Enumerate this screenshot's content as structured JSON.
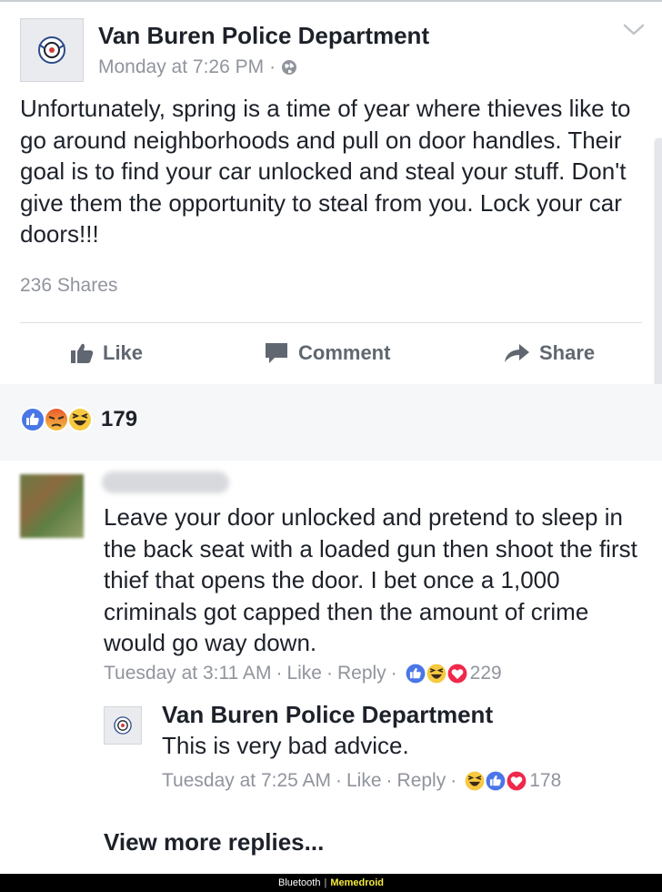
{
  "post": {
    "page_name": "Van Buren Police Department",
    "timestamp": "Monday at 7:26 PM",
    "separator": "·",
    "audience_icon": "globe-icon",
    "body": "Unfortunately, spring is a time of year where thieves like to go around neighborhoods and pull on door handles. Their goal is to find your car unlocked and steal your stuff. Don't give them the opportunity to steal from you. Lock your car doors!!!",
    "shares": "236 Shares",
    "actions": {
      "like": "Like",
      "comment": "Comment",
      "share": "Share"
    },
    "reaction_icons": [
      "like-reaction-icon",
      "angry-reaction-icon",
      "haha-reaction-icon"
    ],
    "reaction_count": "179"
  },
  "comment": {
    "text": "Leave your door unlocked and pretend to sleep in the back seat with a loaded gun then shoot the first thief that opens the door. I bet once a 1,000 criminals got capped then the amount of crime would go way down.",
    "timestamp": "Tuesday at 3:11 AM",
    "like": "Like",
    "reply": "Reply",
    "reaction_icons": [
      "like-reaction-icon",
      "haha-reaction-icon",
      "love-reaction-icon"
    ],
    "reaction_count": "229",
    "sep": "·"
  },
  "reply": {
    "name": "Van Buren Police Department",
    "text": "This is very bad advice.",
    "timestamp": "Tuesday at 7:25 AM",
    "like": "Like",
    "reply": "Reply",
    "reaction_icons": [
      "haha-reaction-icon",
      "like-reaction-icon",
      "love-reaction-icon"
    ],
    "reaction_count": "178",
    "sep": "·"
  },
  "view_more": "View more replies...",
  "footer": {
    "left": "Bluetooth",
    "divider": "|",
    "brand": "Memedroid"
  },
  "colors": {
    "like_blue": "#4a76e8",
    "love_red": "#f0284a",
    "emoji_yellow": "#f7c940",
    "meta_gray": "#90949c"
  }
}
